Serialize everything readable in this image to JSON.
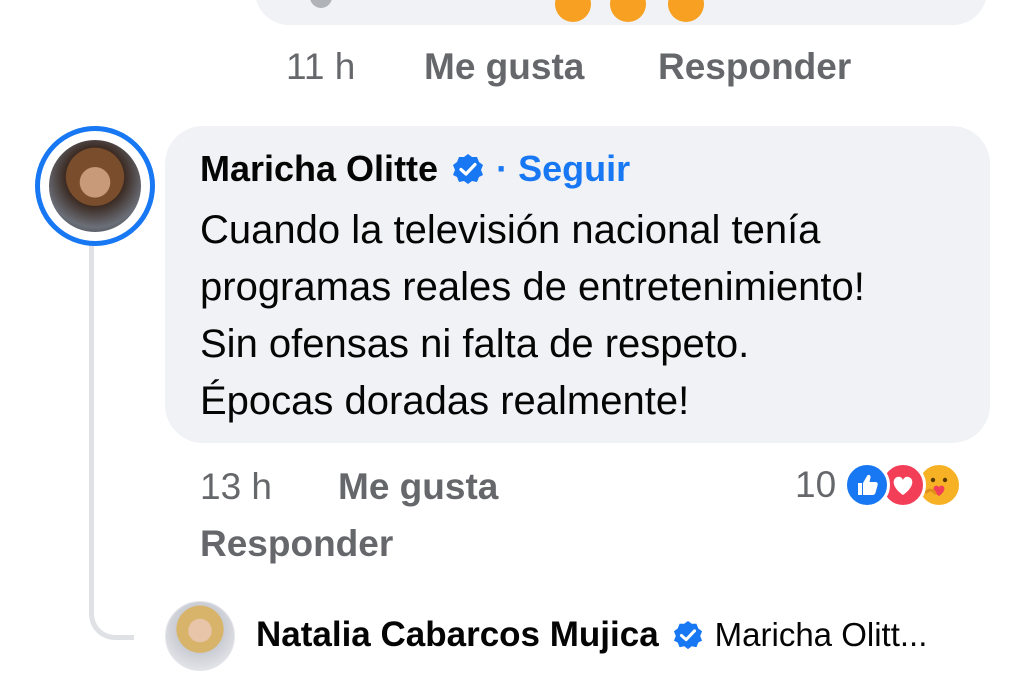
{
  "previous_comment": {
    "time": "11 h",
    "like_label": "Me gusta",
    "reply_label": "Responder"
  },
  "comment": {
    "author": "Maricha Olitte",
    "separator": "·",
    "follow_label": "Seguir",
    "text_lines": [
      "Cuando la televisión nacional tenía",
      "programas reales de entretenimiento!",
      "Sin ofensas ni falta de respeto.",
      "Épocas doradas realmente!"
    ],
    "time": "13 h",
    "like_label": "Me gusta",
    "reply_label": "Responder",
    "reaction_count": "10",
    "reaction_icons": [
      "like-icon",
      "love-icon",
      "care-icon"
    ]
  },
  "reply": {
    "author": "Natalia Cabarcos Mujica",
    "preview": "Maricha Olitt..."
  },
  "colors": {
    "accent": "#1877f2",
    "bubble": "#f0f2f5",
    "meta_text": "#65676b",
    "love": "#f33e58",
    "care": "#f7b125"
  }
}
